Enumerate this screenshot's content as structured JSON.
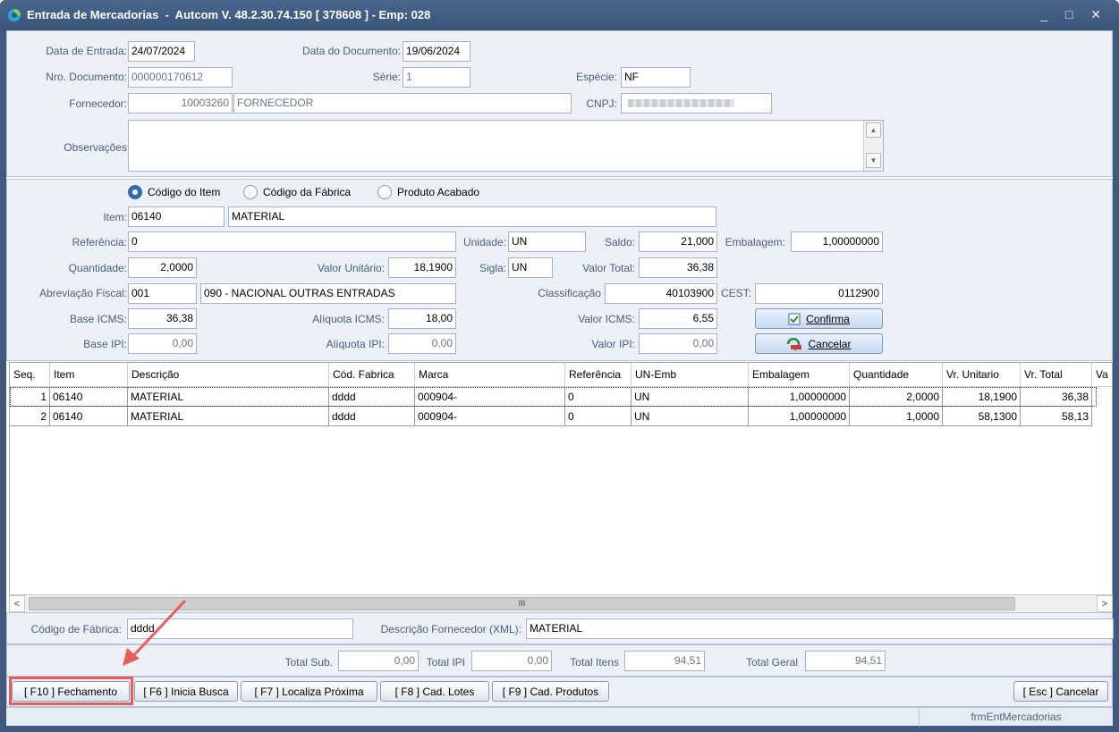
{
  "window": {
    "title": "Entrada de Mercadorias  -  Autcom V. 48.2.30.74.150 [ 378608 ] - Emp: 028",
    "controls": "_ □ ✕"
  },
  "header": {
    "data_entrada_label": "Data de Entrada:",
    "data_entrada": "24/07/2024",
    "data_documento_label": "Data do Documento:",
    "data_documento": "19/06/2024",
    "nro_documento_label": "Nro. Documento:",
    "nro_documento": "000000170612",
    "serie_label": "Série:",
    "serie": "1",
    "especie_label": "Espécie:",
    "especie": "NF",
    "fornecedor_label": "Fornecedor:",
    "fornecedor_codigo": "10003260",
    "fornecedor_nome": "FORNECEDOR",
    "cnpj_label": "CNPJ:",
    "observacoes_label": "Observações"
  },
  "item": {
    "radios": [
      {
        "label": "Código do Item",
        "selected": true
      },
      {
        "label": "Código da Fábrica",
        "selected": false
      },
      {
        "label": "Produto Acabado",
        "selected": false
      }
    ],
    "item_label": "Item:",
    "item_codigo": "06140",
    "item_descricao": "MATERIAL",
    "referencia_label": "Referência:",
    "referencia": "0",
    "unidade_label": "Unidade:",
    "unidade": "UN",
    "saldo_label": "Saldo:",
    "saldo": "21,000",
    "embalagem_label": "Embalagem:",
    "embalagem": "1,00000000",
    "quantidade_label": "Quantidade:",
    "quantidade": "2,0000",
    "valor_unitario_label": "Valor Unitário:",
    "valor_unitario": "18,1900",
    "sigla_label": "Sigla:",
    "sigla": "UN",
    "valor_total_label": "Valor Total:",
    "valor_total": "36,38",
    "abreviacao_fiscal_label": "Abreviação Fiscal:",
    "abreviacao_fiscal": "001",
    "abreviacao_fiscal_desc": "090 - NACIONAL OUTRAS ENTRADAS",
    "classificacao_ipi_label": "Classificação de IPI:",
    "classificacao_ipi": "40103900",
    "cest_label": "CEST:",
    "cest": "0112900",
    "base_icms_label": "Base ICMS:",
    "base_icms": "36,38",
    "aliquota_icms_label": "Alíquota ICMS:",
    "aliquota_icms": "18,00",
    "valor_icms_label": "Valor ICMS:",
    "valor_icms": "6,55",
    "base_ipi_label": "Base IPI:",
    "base_ipi": "0,00",
    "aliquota_ipi_label": "Alíquota IPI:",
    "aliquota_ipi": "0,00",
    "valor_ipi_label": "Valor IPI:",
    "valor_ipi": "0,00",
    "confirma_label": "Confirma",
    "cancelar_label": "Cancelar"
  },
  "grid": {
    "columns": [
      "Seq.",
      "Item",
      "Descrição",
      "Cód. Fabrica",
      "Marca",
      "Referência",
      "UN-Emb",
      "Embalagem",
      "Quantidade",
      "Vr. Unitario",
      "Vr. Total",
      "Va"
    ],
    "rows": [
      [
        "1",
        "06140",
        "MATERIAL",
        "dddd",
        "000904-",
        "0",
        "UN",
        "1,00000000",
        "2,0000",
        "18,1900",
        "36,38"
      ],
      [
        "2",
        "06140",
        "MATERIAL",
        "dddd",
        "000904-",
        "0",
        "UN",
        "1,00000000",
        "1,0000",
        "58,1300",
        "58,13"
      ]
    ]
  },
  "bottom": {
    "codigo_fabrica_label": "Código de Fábrica:",
    "codigo_fabrica": "dddd",
    "descricao_fornecedor_label": "Descrição Fornecedor (XML):",
    "descricao_fornecedor": "MATERIAL",
    "total_sub_label": "Total Sub.",
    "total_sub": "0,00",
    "total_ipi_label": "Total IPI",
    "total_ipi": "0,00",
    "total_itens_label": "Total Itens",
    "total_itens": "94,51",
    "total_geral_label": "Total Geral",
    "total_geral": "94,51"
  },
  "toolbar": {
    "f10": "[ F10 ] Fechamento",
    "f6": "[ F6 ] Inicia Busca",
    "f7": "[ F7 ] Localiza Próxima",
    "f8": "[ F8 ] Cad. Lotes",
    "f9": "[ F9 ] Cad. Produtos",
    "esc": "[ Esc ] Cancelar"
  },
  "status": {
    "form_name": "frmEntMercadorias"
  },
  "colors": {
    "title_bar": "#3f5a7e",
    "panel_bg": "#ecf1f8",
    "highlight": "#e85c5c"
  }
}
